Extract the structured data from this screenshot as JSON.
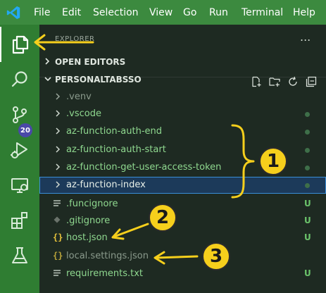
{
  "menubar": {
    "items": [
      "File",
      "Edit",
      "Selection",
      "View",
      "Go",
      "Run",
      "Terminal",
      "Help"
    ]
  },
  "activity_bar": {
    "items": [
      {
        "name": "explorer",
        "icon": "files-icon",
        "active": true
      },
      {
        "name": "search",
        "icon": "search-icon",
        "active": false
      },
      {
        "name": "source-control",
        "icon": "source-control-icon",
        "active": false,
        "badge": "20"
      },
      {
        "name": "run-debug",
        "icon": "run-debug-icon",
        "active": false
      },
      {
        "name": "remote-explorer",
        "icon": "remote-explorer-icon",
        "active": false
      },
      {
        "name": "extensions",
        "icon": "extensions-icon",
        "active": false
      },
      {
        "name": "testing",
        "icon": "flask-icon",
        "active": false
      }
    ]
  },
  "explorer": {
    "title": "EXPLORER",
    "more": "...",
    "open_editors_label": "OPEN EDITORS",
    "project_label": "PERSONALTABSSO",
    "toolbar": [
      "new-file-icon",
      "new-folder-icon",
      "refresh-icon",
      "collapse-all-icon"
    ],
    "tree": [
      {
        "name": ".venv",
        "kind": "folder",
        "status": "",
        "style": "dim"
      },
      {
        "name": ".vscode",
        "kind": "folder",
        "status": "dot",
        "style": "green"
      },
      {
        "name": "az-function-auth-end",
        "kind": "folder",
        "status": "dot",
        "style": "green"
      },
      {
        "name": "az-function-auth-start",
        "kind": "folder",
        "status": "dot",
        "style": "green"
      },
      {
        "name": "az-function-get-user-access-token",
        "kind": "folder",
        "status": "dot",
        "style": "green"
      },
      {
        "name": "az-function-index",
        "kind": "folder",
        "status": "dot",
        "style": "green",
        "selected": true
      },
      {
        "name": ".funcignore",
        "kind": "file-lines",
        "status": "U",
        "style": "green"
      },
      {
        "name": ".gitignore",
        "kind": "file-git",
        "status": "U",
        "style": "green"
      },
      {
        "name": "host.json",
        "kind": "file-json",
        "status": "U",
        "style": "green"
      },
      {
        "name": "local.settings.json",
        "kind": "file-json",
        "status": "",
        "style": "dim"
      },
      {
        "name": "requirements.txt",
        "kind": "file-lines",
        "status": "U",
        "style": "green"
      }
    ]
  },
  "annotations": {
    "callouts": [
      "1",
      "2",
      "3"
    ],
    "accent": "#f6cf1c"
  },
  "colors": {
    "menubar": "#3c8a3f",
    "activity_bar": "#2f7d32",
    "sidebar": "#1e2a22",
    "selected_row": "#1c3a5a",
    "badge": "#4a48a8",
    "file_green": "#8fd88f"
  }
}
